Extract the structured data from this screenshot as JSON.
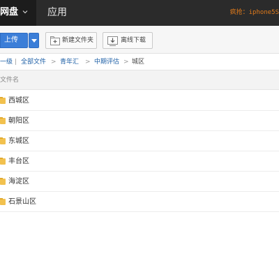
{
  "topbar": {
    "brand": "网盘",
    "app_tab": "应用",
    "promo_prefix": "疯抢：",
    "promo_model": "iphone5S"
  },
  "toolbar": {
    "upload_label": "上传",
    "new_folder_label": "新建文件夹",
    "offline_download_label": "离线下载"
  },
  "breadcrumb": {
    "back": "一级",
    "items": [
      "全部文件",
      "青年汇",
      "中期评估"
    ],
    "separator": ">",
    "current": "城区"
  },
  "list_header": {
    "name_column": "文件名"
  },
  "files": [
    {
      "name": "西城区"
    },
    {
      "name": "朝阳区"
    },
    {
      "name": "东城区"
    },
    {
      "name": "丰台区"
    },
    {
      "name": "海淀区"
    },
    {
      "name": "石景山区"
    }
  ],
  "colors": {
    "topbar_bg": "#2b2b2b",
    "accent_blue": "#3b7ed8",
    "link_blue": "#1d5fa6",
    "promo_orange": "#e07a1a",
    "folder_yellow": "#f2c14e"
  }
}
